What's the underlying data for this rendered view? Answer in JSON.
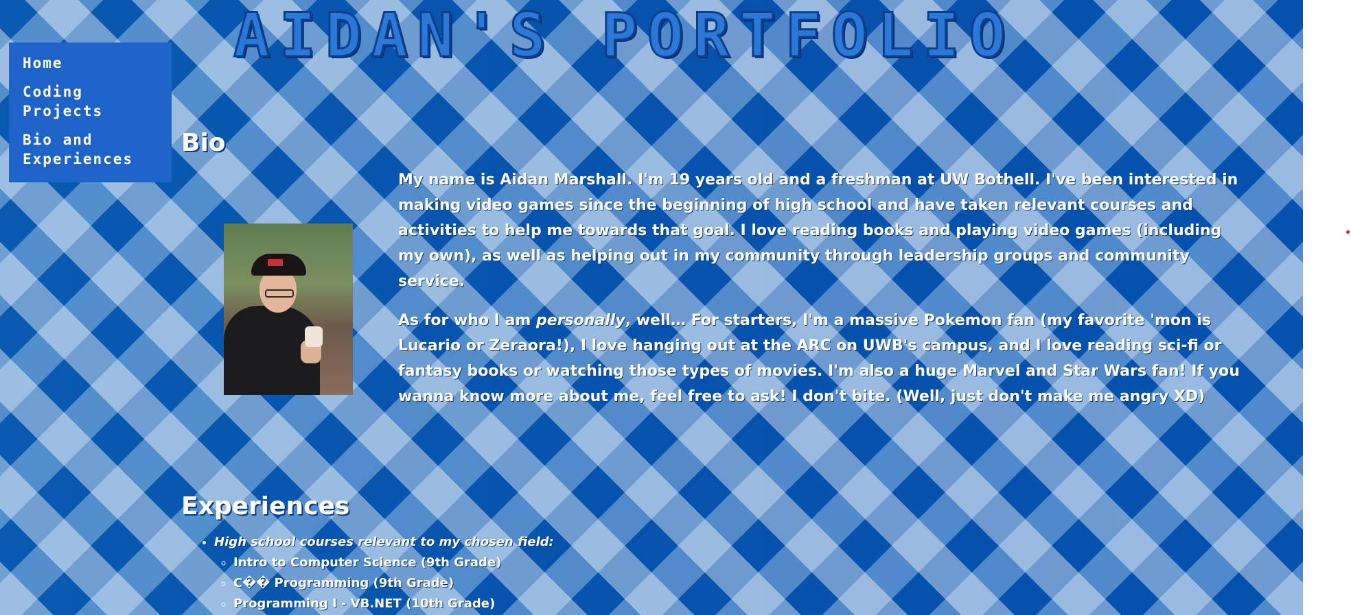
{
  "site": {
    "title": "AIDAN'S PORTFOLIO"
  },
  "nav": {
    "items": [
      {
        "label": "Home"
      },
      {
        "label": "Coding Projects"
      },
      {
        "label": "Bio and Experiences"
      }
    ]
  },
  "bio": {
    "title": "Bio",
    "paragraph1": "My name is Aidan Marshall. I'm 19 years old and a freshman at UW Bothell. I've been interested in making video games since the beginning of high school and have taken relevant courses and activities to help me towards that goal. I love reading books and playing video games (including my own), as well as helping out in my community through leadership groups and community service.",
    "paragraph2_before": "As for who I am ",
    "paragraph2_emphasis": "personally",
    "paragraph2_after": ", well… For starters, I'm a massive Pokemon fan (my favorite 'mon is Lucario or Zeraora!), I love hanging out at the ARC on UWB's campus, and I love reading sci-fi or fantasy books or watching those types of movies. I'm also a huge Marvel and Star Wars fan! If you wanna know more about me, feel free to ask! I don't bite. (Well, just don't make me angry XD)"
  },
  "experiences": {
    "title": "Experiences",
    "group_label": "High school courses relevant to my chosen field:",
    "courses": [
      "Intro to Computer Science (9th Grade)",
      "C�� Programming (9th Grade)",
      "Programming I - VB.NET (10th Grade)"
    ]
  },
  "colors": {
    "background_primary": "#0a5fb8",
    "nav_background": "#1e64c8",
    "text": "#ffffff",
    "marker_dot": "#d82020"
  }
}
